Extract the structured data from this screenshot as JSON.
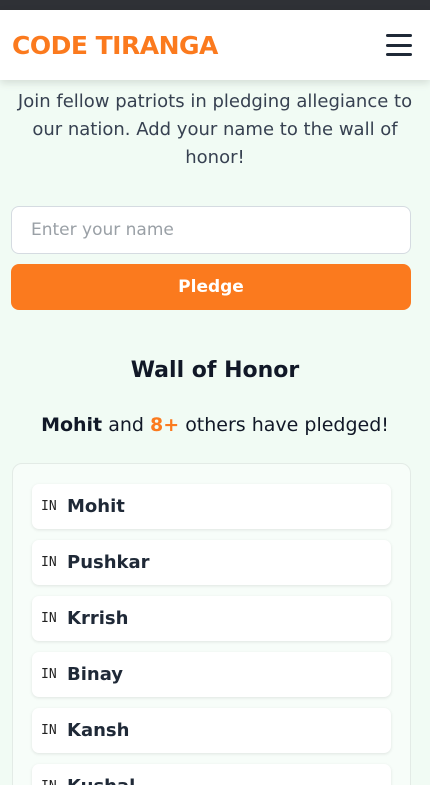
{
  "header": {
    "brand": "CODE TIRANGA"
  },
  "intro": "Join fellow patriots in pledging allegiance to our nation. Add your name to the wall of honor!",
  "form": {
    "placeholder": "Enter your name",
    "button_label": "Pledge"
  },
  "wall": {
    "title": "Wall of Honor",
    "latest_name": "Mohit",
    "connector": "and",
    "count": "8+",
    "suffix": "others have pledged!"
  },
  "pledges": [
    {
      "flag": "IN",
      "name": "Mohit"
    },
    {
      "flag": "IN",
      "name": "Pushkar"
    },
    {
      "flag": "IN",
      "name": "Krrish"
    },
    {
      "flag": "IN",
      "name": "Binay"
    },
    {
      "flag": "IN",
      "name": "Kansh"
    },
    {
      "flag": "IN",
      "name": "Kushal"
    }
  ],
  "colors": {
    "accent": "#fb7a1e",
    "background": "#f1fbf4"
  }
}
